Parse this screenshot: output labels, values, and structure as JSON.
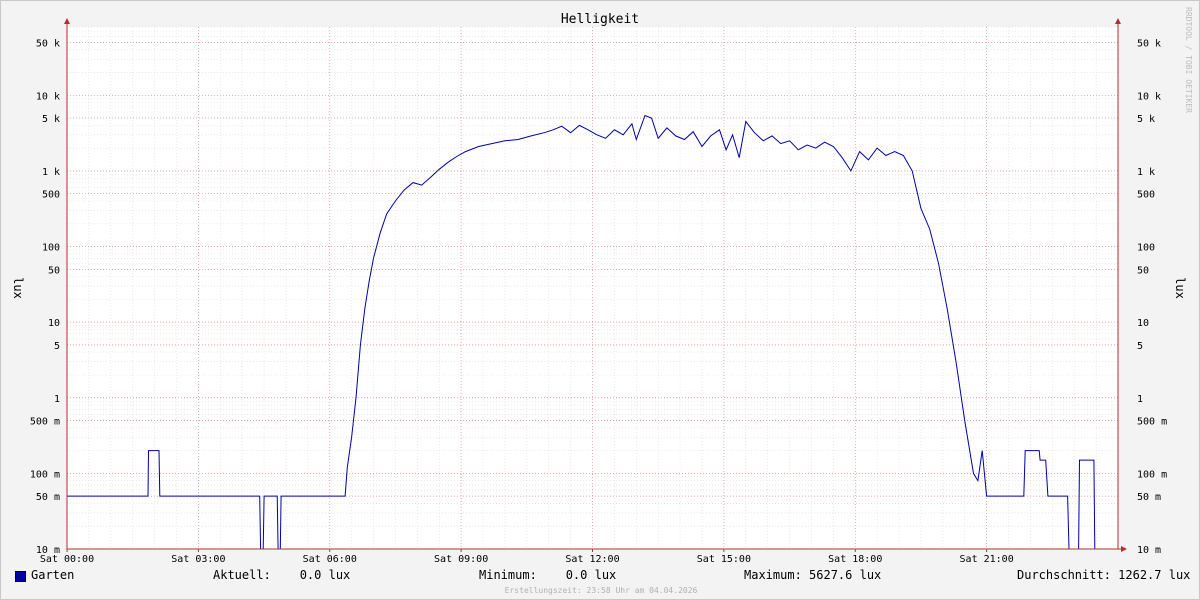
{
  "chart_data": {
    "type": "line",
    "title": "Helligkeit",
    "ylabel_left": "lux",
    "ylabel_right": "lux",
    "yscale": "log",
    "ylim": [
      0.01,
      80000
    ],
    "xlim_hours": [
      0,
      24
    ],
    "x_ticks": [
      {
        "h": 0,
        "label": "Sat 00:00"
      },
      {
        "h": 3,
        "label": "Sat 03:00"
      },
      {
        "h": 6,
        "label": "Sat 06:00"
      },
      {
        "h": 9,
        "label": "Sat 09:00"
      },
      {
        "h": 12,
        "label": "Sat 12:00"
      },
      {
        "h": 15,
        "label": "Sat 15:00"
      },
      {
        "h": 18,
        "label": "Sat 18:00"
      },
      {
        "h": 21,
        "label": "Sat 21:00"
      }
    ],
    "y_ticks": [
      {
        "v": 50000,
        "label": "50 k"
      },
      {
        "v": 10000,
        "label": "10 k"
      },
      {
        "v": 5000,
        "label": "5 k"
      },
      {
        "v": 1000,
        "label": "1 k"
      },
      {
        "v": 500,
        "label": "500"
      },
      {
        "v": 100,
        "label": "100"
      },
      {
        "v": 50,
        "label": "50"
      },
      {
        "v": 10,
        "label": "10"
      },
      {
        "v": 5,
        "label": "5"
      },
      {
        "v": 1,
        "label": "1"
      },
      {
        "v": 0.5,
        "label": "500 m"
      },
      {
        "v": 0.1,
        "label": "100 m"
      },
      {
        "v": 0.05,
        "label": "50 m"
      },
      {
        "v": 0.01,
        "label": "10 m"
      }
    ],
    "series": [
      {
        "name": "Garten",
        "color": "#0000aa",
        "points": [
          [
            0,
            0.05
          ],
          [
            1.85,
            0.05
          ],
          [
            1.86,
            0.2
          ],
          [
            2.1,
            0.2
          ],
          [
            2.12,
            0.05
          ],
          [
            4.4,
            0.05
          ],
          [
            4.42,
            0.01
          ],
          [
            4.48,
            0.01
          ],
          [
            4.5,
            0.05
          ],
          [
            4.8,
            0.05
          ],
          [
            4.82,
            0.01
          ],
          [
            4.87,
            0.01
          ],
          [
            4.89,
            0.05
          ],
          [
            6.35,
            0.05
          ],
          [
            6.4,
            0.12
          ],
          [
            6.5,
            0.3
          ],
          [
            6.6,
            1
          ],
          [
            6.7,
            5
          ],
          [
            6.8,
            15
          ],
          [
            6.9,
            35
          ],
          [
            7.0,
            70
          ],
          [
            7.15,
            150
          ],
          [
            7.3,
            270
          ],
          [
            7.5,
            400
          ],
          [
            7.7,
            560
          ],
          [
            7.9,
            700
          ],
          [
            8.1,
            650
          ],
          [
            8.3,
            820
          ],
          [
            8.5,
            1050
          ],
          [
            8.7,
            1300
          ],
          [
            8.9,
            1550
          ],
          [
            9.1,
            1800
          ],
          [
            9.4,
            2100
          ],
          [
            9.7,
            2300
          ],
          [
            10.0,
            2500
          ],
          [
            10.3,
            2600
          ],
          [
            10.6,
            2900
          ],
          [
            10.9,
            3200
          ],
          [
            11.1,
            3500
          ],
          [
            11.3,
            3900
          ],
          [
            11.5,
            3200
          ],
          [
            11.7,
            4000
          ],
          [
            11.9,
            3500
          ],
          [
            12.1,
            3000
          ],
          [
            12.3,
            2700
          ],
          [
            12.5,
            3500
          ],
          [
            12.7,
            3000
          ],
          [
            12.9,
            4200
          ],
          [
            13.0,
            2600
          ],
          [
            13.2,
            5400
          ],
          [
            13.35,
            5000
          ],
          [
            13.5,
            2700
          ],
          [
            13.7,
            3700
          ],
          [
            13.9,
            2900
          ],
          [
            14.1,
            2600
          ],
          [
            14.3,
            3300
          ],
          [
            14.5,
            2100
          ],
          [
            14.7,
            2900
          ],
          [
            14.9,
            3500
          ],
          [
            15.05,
            1900
          ],
          [
            15.2,
            3000
          ],
          [
            15.35,
            1500
          ],
          [
            15.5,
            4500
          ],
          [
            15.7,
            3200
          ],
          [
            15.9,
            2500
          ],
          [
            16.1,
            2900
          ],
          [
            16.3,
            2300
          ],
          [
            16.5,
            2500
          ],
          [
            16.7,
            1900
          ],
          [
            16.9,
            2200
          ],
          [
            17.1,
            2000
          ],
          [
            17.3,
            2400
          ],
          [
            17.5,
            2100
          ],
          [
            17.7,
            1500
          ],
          [
            17.9,
            1000
          ],
          [
            18.1,
            1800
          ],
          [
            18.3,
            1400
          ],
          [
            18.5,
            2000
          ],
          [
            18.7,
            1600
          ],
          [
            18.9,
            1800
          ],
          [
            19.1,
            1600
          ],
          [
            19.3,
            1000
          ],
          [
            19.5,
            320
          ],
          [
            19.7,
            170
          ],
          [
            19.9,
            60
          ],
          [
            20.1,
            15
          ],
          [
            20.3,
            3
          ],
          [
            20.5,
            0.5
          ],
          [
            20.7,
            0.1
          ],
          [
            20.8,
            0.08
          ],
          [
            20.9,
            0.2
          ],
          [
            21.0,
            0.05
          ],
          [
            21.85,
            0.05
          ],
          [
            21.88,
            0.2
          ],
          [
            22.2,
            0.2
          ],
          [
            22.22,
            0.15
          ],
          [
            22.35,
            0.15
          ],
          [
            22.4,
            0.05
          ],
          [
            22.85,
            0.05
          ],
          [
            22.88,
            0.01
          ],
          [
            23.1,
            0.01
          ],
          [
            23.12,
            0.15
          ],
          [
            23.45,
            0.15
          ],
          [
            23.47,
            0.01
          ],
          [
            23.9,
            0.01
          ]
        ]
      }
    ]
  },
  "legend": {
    "series_name": "Garten",
    "current": "Aktuell:    0.0 lux",
    "minimum": "Minimum:    0.0 lux",
    "maximum": "Maximum: 5627.6 lux",
    "average": "Durchschnitt: 1262.7 lux"
  },
  "footer": "Erstellungszeit: 23:58 Uhr am 04.04.2026",
  "watermark": "RRDTOOL / TOBI OETIKER"
}
